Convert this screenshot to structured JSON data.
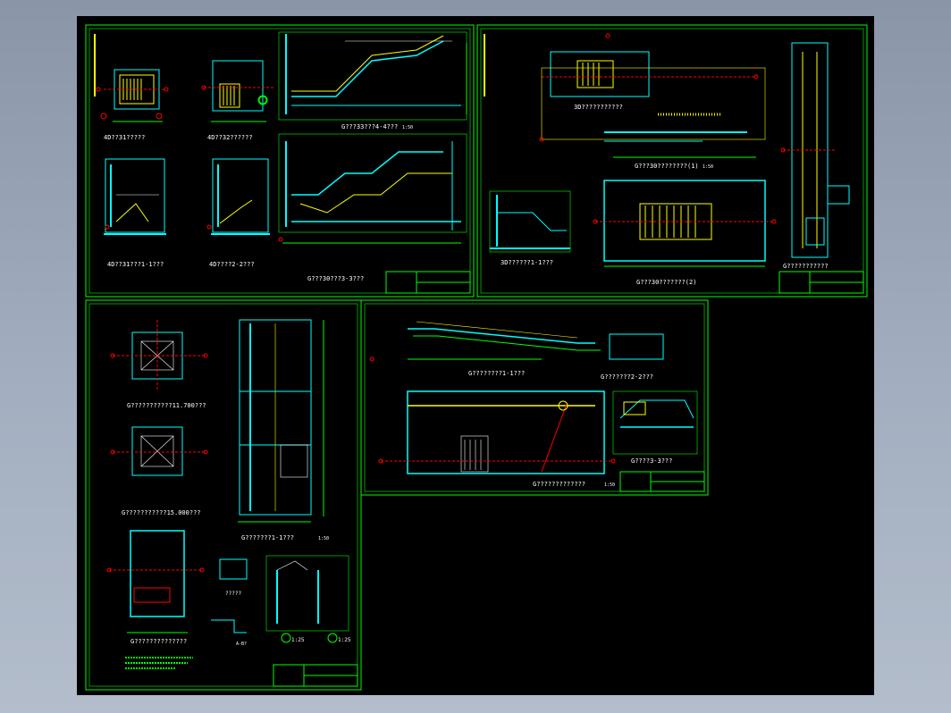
{
  "colors": {
    "background": "#000000",
    "frame": "#00ff00",
    "wall": "#00ffff",
    "stair": "#ffff00",
    "axis": "#ff0000",
    "text": "#ffffff",
    "dimension": "#00ff00",
    "fill": "#00ffff"
  },
  "sheet1": {
    "title_a": "4D??31?????",
    "title_b": "4D??32??????",
    "title_c": "4D??31???1-1???",
    "title_d": "4D????2-2???",
    "title_e": "G???33???4-4???",
    "title_f": "G???30???3-3???",
    "scale": "1:50"
  },
  "sheet2": {
    "title_a": "3D???????????",
    "title_b": "G???30????????(1)",
    "title_c": "3D??????1-1???",
    "title_d": "G???30???????(2)",
    "title_e": "G???????????",
    "scale": "1:50"
  },
  "sheet3": {
    "title_a": "G???????????11.700???",
    "title_b": "G???????????15.000???",
    "title_c": "G??????????????",
    "title_d": "G???????1-1???",
    "title_e": "?????",
    "scale": "1:50",
    "scale_detail": "1:25",
    "label_a": "A-B?"
  },
  "sheet4": {
    "title_a": "G????????1-1???",
    "title_b": "G???????2-2???",
    "title_c": "G????3-3???",
    "title_d": "G?????????????",
    "scale": "1:50"
  }
}
